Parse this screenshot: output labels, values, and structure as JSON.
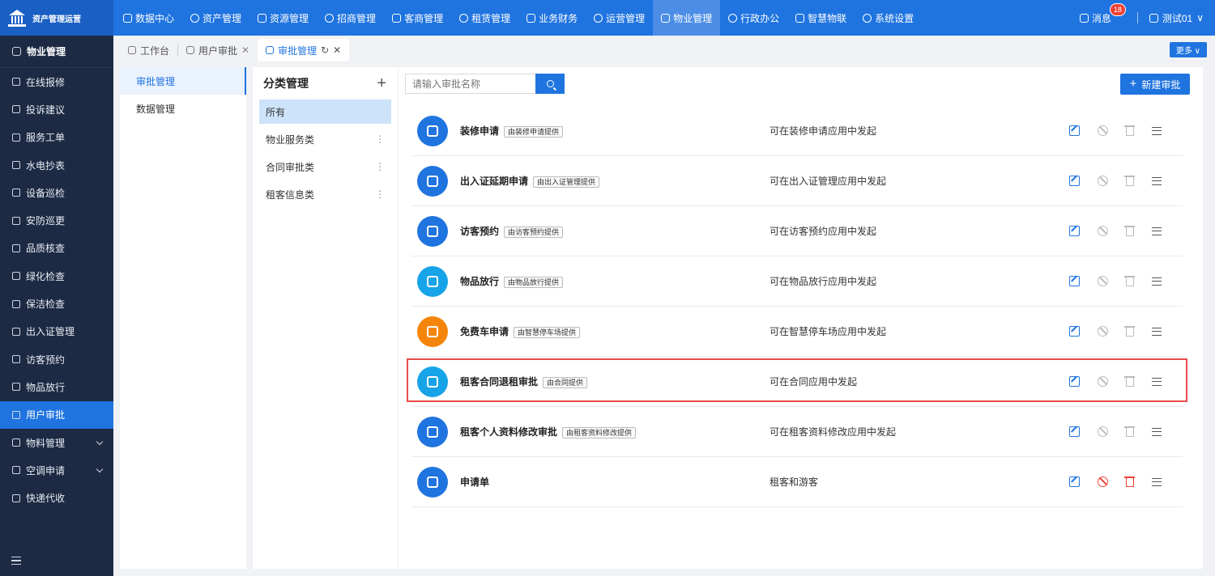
{
  "app": {
    "title": "资产管理运营"
  },
  "topnav": [
    {
      "label": "数据中心",
      "icon": "chart-icon"
    },
    {
      "label": "资产管理",
      "icon": "cube-icon"
    },
    {
      "label": "资源管理",
      "icon": "document-icon"
    },
    {
      "label": "招商管理",
      "icon": "tag-icon"
    },
    {
      "label": "客商管理",
      "icon": "people-icon"
    },
    {
      "label": "租赁管理",
      "icon": "building-icon"
    },
    {
      "label": "业务财务",
      "icon": "coin-icon"
    },
    {
      "label": "运营管理",
      "icon": "grid-icon"
    },
    {
      "label": "物业管理",
      "icon": "home-icon",
      "active": true
    },
    {
      "label": "行政办公",
      "icon": "monitor-icon"
    },
    {
      "label": "智慧物联",
      "icon": "sun-icon"
    },
    {
      "label": "系统设置",
      "icon": "gear-icon"
    }
  ],
  "header": {
    "messages_label": "消息",
    "messages_badge": "18",
    "user_label": "测试01"
  },
  "sidebar": {
    "title": "物业管理",
    "items": [
      {
        "label": "在线报修"
      },
      {
        "label": "投诉建议"
      },
      {
        "label": "服务工单"
      },
      {
        "label": "水电抄表"
      },
      {
        "label": "设备巡检"
      },
      {
        "label": "安防巡更"
      },
      {
        "label": "品质核查"
      },
      {
        "label": "绿化检查"
      },
      {
        "label": "保洁检查"
      },
      {
        "label": "出入证管理"
      },
      {
        "label": "访客预约"
      },
      {
        "label": "物品放行"
      },
      {
        "label": "用户审批",
        "active": true
      },
      {
        "label": "物料管理",
        "chevron": true
      },
      {
        "label": "空调申请",
        "chevron": true
      },
      {
        "label": "快递代收"
      }
    ]
  },
  "tabs": [
    {
      "label": "工作台"
    },
    {
      "label": "用户审批"
    },
    {
      "label": "审批管理",
      "active": true
    }
  ],
  "tabbar": {
    "more_label": "更多"
  },
  "submenu": [
    {
      "label": "审批管理",
      "active": true
    },
    {
      "label": "数据管理"
    }
  ],
  "categories": {
    "title": "分类管理",
    "items": [
      {
        "label": "所有",
        "active": true
      },
      {
        "label": "物业服务类"
      },
      {
        "label": "合同审批类"
      },
      {
        "label": "租客信息类"
      }
    ]
  },
  "search": {
    "placeholder": "请输入审批名称"
  },
  "new_button_label": "新建审批",
  "approvals": [
    {
      "name": "装修申请",
      "tag": "由装修申请提供",
      "desc": "可在装修申请应用中发起",
      "color": "#1f74e0"
    },
    {
      "name": "出入证延期申请",
      "tag": "由出入证管理提供",
      "desc": "可在出入证管理应用中发起",
      "color": "#1f74e0"
    },
    {
      "name": "访客预约",
      "tag": "由访客预约提供",
      "desc": "可在访客预约应用中发起",
      "color": "#1f74e0"
    },
    {
      "name": "物品放行",
      "tag": "由物品放行提供",
      "desc": "可在物品放行应用中发起",
      "color": "#16a3e8"
    },
    {
      "name": "免费车申请",
      "tag": "由智慧停车场提供",
      "desc": "可在智慧停车场应用中发起",
      "color": "#f5850a"
    },
    {
      "name": "租客合同退租审批",
      "tag": "由合同提供",
      "desc": "可在合同应用中发起",
      "color": "#16a3e8",
      "highlighted": true
    },
    {
      "name": "租客个人资料修改审批",
      "tag": "由租客资料修改提供",
      "desc": "可在租客资料修改应用中发起",
      "color": "#1f74e0"
    },
    {
      "name": "申请单",
      "tag": "",
      "desc": "租客和游客",
      "color": "#1f74e0",
      "deletable": true
    }
  ]
}
